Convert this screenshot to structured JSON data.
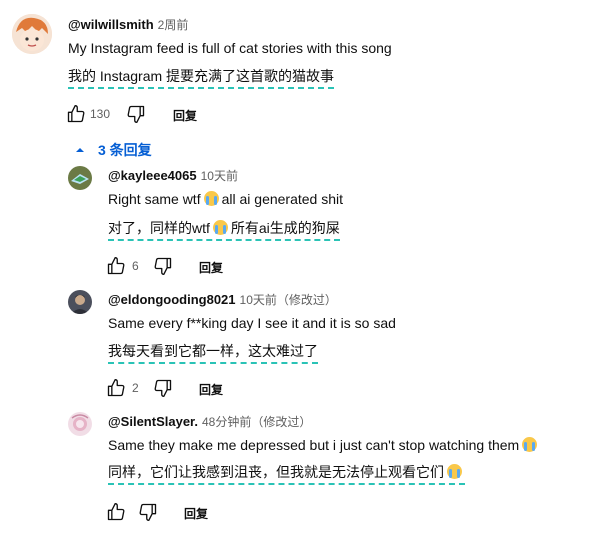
{
  "comment": {
    "author": "@wilwillsmith",
    "time": "2周前",
    "text": "My Instagram feed is full of cat stories with this song",
    "translation": "我的 Instagram 提要充满了这首歌的猫故事",
    "likes": "130",
    "reply_label": "回复"
  },
  "replies_toggle": {
    "label": "3 条回复",
    "icon": "caret-up-icon"
  },
  "replies": [
    {
      "author": "@kayleee4065",
      "time": "10天前",
      "text_before": "Right same wtf",
      "text_after": "all ai generated shit",
      "translation_before": "对了，同样的wtf",
      "translation_after": "所有ai生成的狗屎",
      "likes": "6",
      "reply_label": "回复"
    },
    {
      "author": "@eldongooding8021",
      "time": "10天前（修改过）",
      "text": "Same every f**king day I see it and it is so sad",
      "translation": "我每天看到它都一样，这太难过了",
      "likes": "2",
      "reply_label": "回复"
    },
    {
      "author": "@SilentSlayer.",
      "time": "48分钟前（修改过）",
      "text": "Same they make me depressed but i just can't stop watching them",
      "translation": "同样，它们让我感到沮丧，但我就是无法停止观看它们",
      "reply_label": "回复"
    }
  ],
  "colors": {
    "link": "#065fd4",
    "translation_underline": "#2ac3b6",
    "meta": "#606060"
  },
  "emoji": "loudly-crying-face-emoji"
}
